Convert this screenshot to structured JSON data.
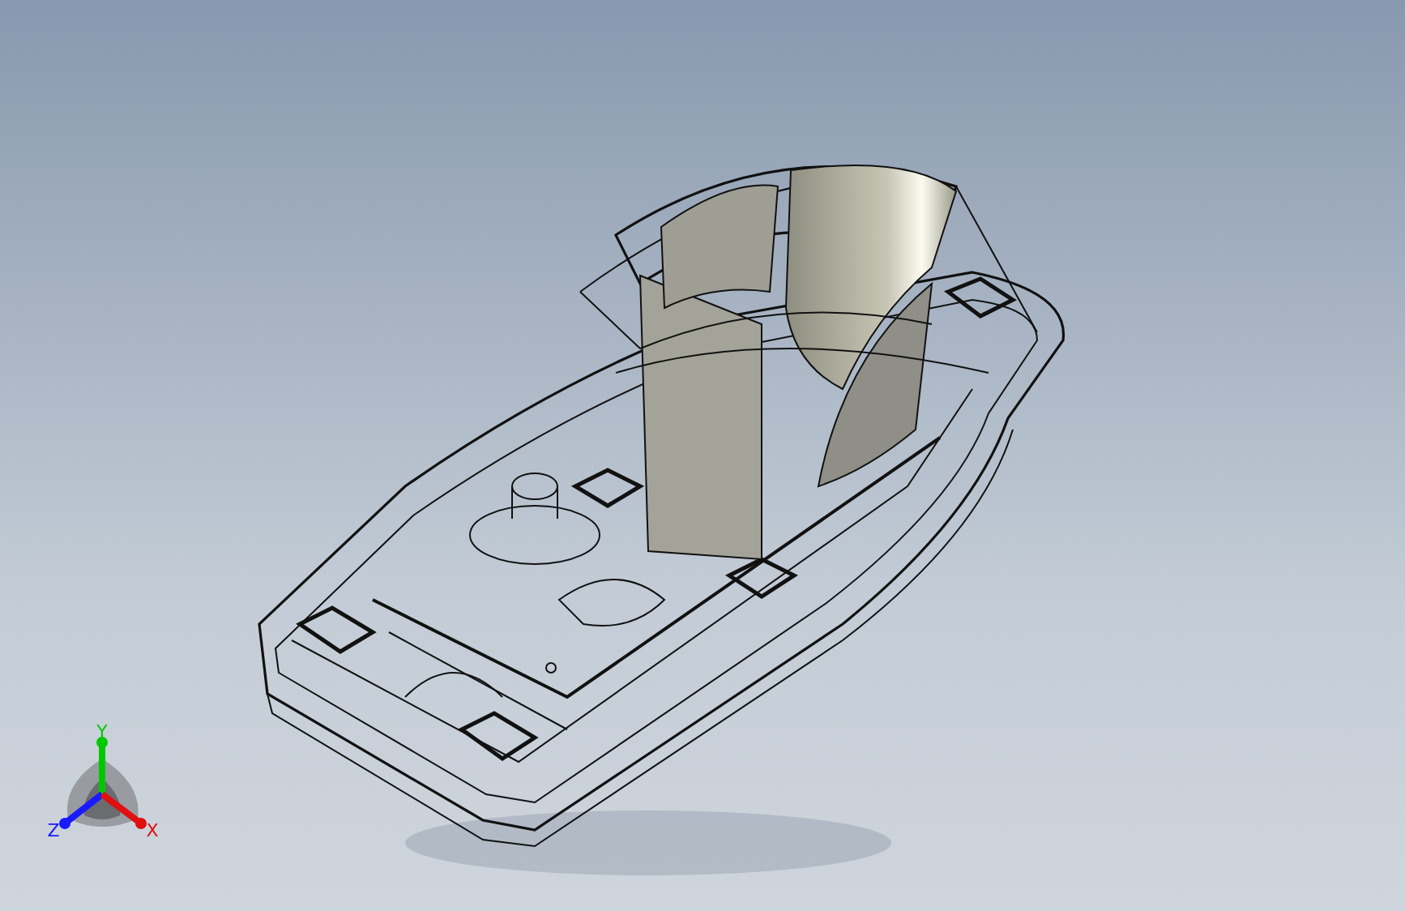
{
  "viewport": {
    "triad": {
      "axes": [
        {
          "label": "Y",
          "color": "#00c800"
        },
        {
          "label": "Z",
          "color": "#1a1aff"
        },
        {
          "label": "X",
          "color": "#e01010"
        }
      ]
    }
  }
}
